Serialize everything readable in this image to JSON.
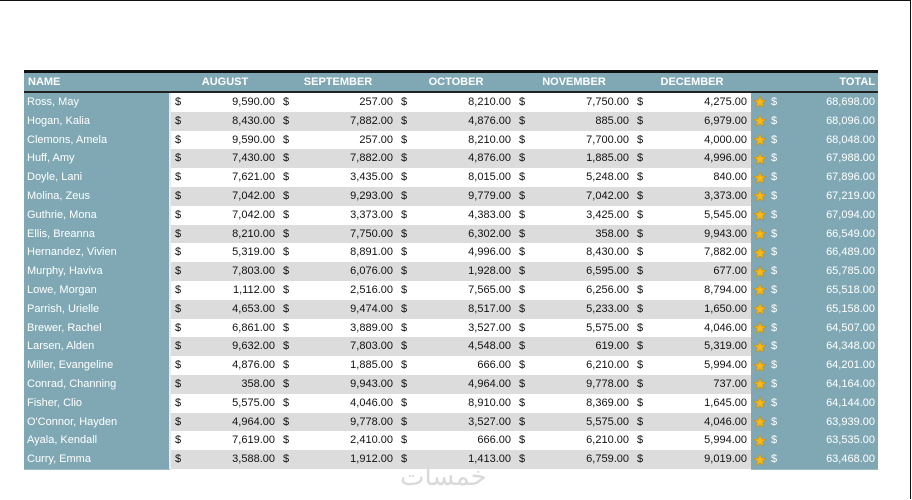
{
  "headers": {
    "name": "NAME",
    "august": "AUGUST",
    "september": "SEPTEMBER",
    "october": "OCTOBER",
    "november": "NOVEMBER",
    "december": "DECEMBER",
    "total": "TOTAL"
  },
  "currency": "$",
  "star_color": "#f5b81c",
  "rows": [
    {
      "name": "Ross, May",
      "aug": "9,590.00",
      "sep": "257.00",
      "oct": "8,210.00",
      "nov": "7,750.00",
      "dec": "4,275.00",
      "total": "68,698.00"
    },
    {
      "name": "Hogan, Kalia",
      "aug": "8,430.00",
      "sep": "7,882.00",
      "oct": "4,876.00",
      "nov": "885.00",
      "dec": "6,979.00",
      "total": "68,096.00"
    },
    {
      "name": "Clemons, Amela",
      "aug": "9,590.00",
      "sep": "257.00",
      "oct": "8,210.00",
      "nov": "7,700.00",
      "dec": "4,000.00",
      "total": "68,048.00"
    },
    {
      "name": "Huff, Amy",
      "aug": "7,430.00",
      "sep": "7,882.00",
      "oct": "4,876.00",
      "nov": "1,885.00",
      "dec": "4,996.00",
      "total": "67,988.00"
    },
    {
      "name": "Doyle, Lani",
      "aug": "7,621.00",
      "sep": "3,435.00",
      "oct": "8,015.00",
      "nov": "5,248.00",
      "dec": "840.00",
      "total": "67,896.00"
    },
    {
      "name": "Molina, Zeus",
      "aug": "7,042.00",
      "sep": "9,293.00",
      "oct": "9,779.00",
      "nov": "7,042.00",
      "dec": "3,373.00",
      "total": "67,219.00"
    },
    {
      "name": "Guthrie, Mona",
      "aug": "7,042.00",
      "sep": "3,373.00",
      "oct": "4,383.00",
      "nov": "3,425.00",
      "dec": "5,545.00",
      "total": "67,094.00"
    },
    {
      "name": "Ellis, Breanna",
      "aug": "8,210.00",
      "sep": "7,750.00",
      "oct": "6,302.00",
      "nov": "358.00",
      "dec": "9,943.00",
      "total": "66,549.00"
    },
    {
      "name": "Hernandez, Vivien",
      "aug": "5,319.00",
      "sep": "8,891.00",
      "oct": "4,996.00",
      "nov": "8,430.00",
      "dec": "7,882.00",
      "total": "66,489.00"
    },
    {
      "name": "Murphy, Haviva",
      "aug": "7,803.00",
      "sep": "6,076.00",
      "oct": "1,928.00",
      "nov": "6,595.00",
      "dec": "677.00",
      "total": "65,785.00"
    },
    {
      "name": "Lowe, Morgan",
      "aug": "1,112.00",
      "sep": "2,516.00",
      "oct": "7,565.00",
      "nov": "6,256.00",
      "dec": "8,794.00",
      "total": "65,518.00"
    },
    {
      "name": "Parrish, Urielle",
      "aug": "4,653.00",
      "sep": "9,474.00",
      "oct": "8,517.00",
      "nov": "5,233.00",
      "dec": "1,650.00",
      "total": "65,158.00"
    },
    {
      "name": "Brewer, Rachel",
      "aug": "6,861.00",
      "sep": "3,889.00",
      "oct": "3,527.00",
      "nov": "5,575.00",
      "dec": "4,046.00",
      "total": "64,507.00"
    },
    {
      "name": "Larsen, Alden",
      "aug": "9,632.00",
      "sep": "7,803.00",
      "oct": "4,548.00",
      "nov": "619.00",
      "dec": "5,319.00",
      "total": "64,348.00"
    },
    {
      "name": "Miller, Evangeline",
      "aug": "4,876.00",
      "sep": "1,885.00",
      "oct": "666.00",
      "nov": "6,210.00",
      "dec": "5,994.00",
      "total": "64,201.00"
    },
    {
      "name": "Conrad, Channing",
      "aug": "358.00",
      "sep": "9,943.00",
      "oct": "4,964.00",
      "nov": "9,778.00",
      "dec": "737.00",
      "total": "64,164.00"
    },
    {
      "name": "Fisher, Clio",
      "aug": "5,575.00",
      "sep": "4,046.00",
      "oct": "8,910.00",
      "nov": "8,369.00",
      "dec": "1,645.00",
      "total": "64,144.00"
    },
    {
      "name": "O'Connor, Hayden",
      "aug": "4,964.00",
      "sep": "9,778.00",
      "oct": "3,527.00",
      "nov": "5,575.00",
      "dec": "4,046.00",
      "total": "63,939.00"
    },
    {
      "name": "Ayala, Kendall",
      "aug": "7,619.00",
      "sep": "2,410.00",
      "oct": "666.00",
      "nov": "6,210.00",
      "dec": "5,994.00",
      "total": "63,535.00"
    },
    {
      "name": "Curry, Emma",
      "aug": "3,588.00",
      "sep": "1,912.00",
      "oct": "1,413.00",
      "nov": "6,759.00",
      "dec": "9,019.00",
      "total": "63,468.00"
    }
  ],
  "watermark": "خمسات"
}
